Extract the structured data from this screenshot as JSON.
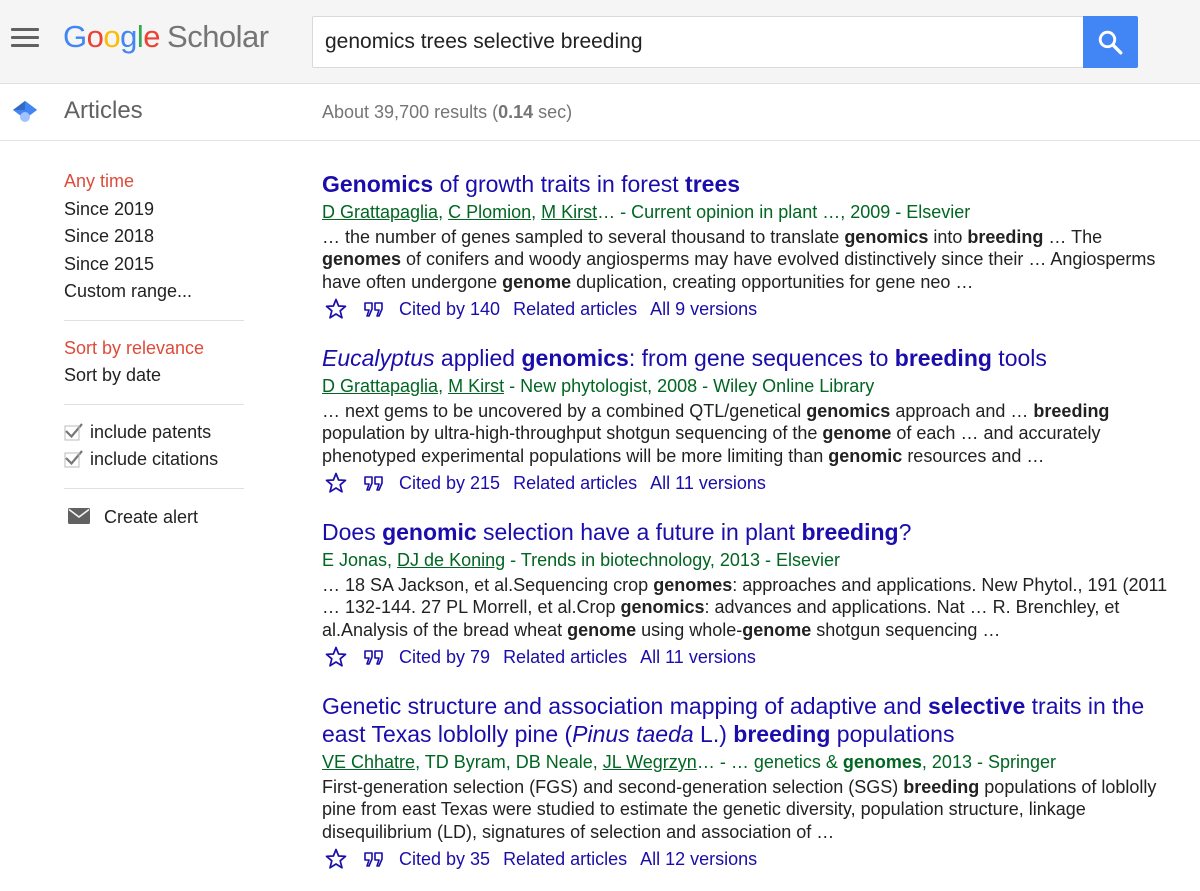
{
  "header": {
    "logo_parts": [
      "G",
      "o",
      "o",
      "g",
      "l",
      "e"
    ],
    "logo_product": "Scholar",
    "search_query": "genomics trees selective breeding",
    "brand_colors": {
      "blue": "#4285f4",
      "red": "#ea4335",
      "yellow": "#fbbc05",
      "green": "#34a853"
    }
  },
  "subheader": {
    "section": "Articles",
    "results_prefix": "About 39,700 results (",
    "results_time": "0.14",
    "results_suffix": " sec)"
  },
  "sidebar": {
    "time_filters": [
      "Any time",
      "Since 2019",
      "Since 2018",
      "Since 2015",
      "Custom range..."
    ],
    "sort_options": [
      "Sort by relevance",
      "Sort by date"
    ],
    "checkboxes": [
      "include patents",
      "include citations"
    ],
    "create_alert": "Create alert",
    "active_color": "#dd4b39"
  },
  "results": [
    {
      "title": [
        {
          "t": "Genomics",
          "b": true
        },
        {
          "t": " of growth traits in forest "
        },
        {
          "t": "trees",
          "b": true
        }
      ],
      "meta": [
        {
          "t": "D Grattapaglia",
          "u": true
        },
        {
          "t": ", "
        },
        {
          "t": "C Plomion",
          "u": true
        },
        {
          "t": ", "
        },
        {
          "t": "M Kirst",
          "u": true
        },
        {
          "t": "… - Current opinion in plant …, 2009 - Elsevier"
        }
      ],
      "snippet": [
        {
          "t": "… the number of genes sampled to several thousand to translate "
        },
        {
          "t": "genomics",
          "b": true
        },
        {
          "t": " into "
        },
        {
          "t": "breeding",
          "b": true
        },
        {
          "t": " … The "
        },
        {
          "t": "genomes",
          "b": true
        },
        {
          "t": " of conifers and woody angiosperms may have evolved distinctively since their … Angiosperms have often undergone "
        },
        {
          "t": "genome",
          "b": true
        },
        {
          "t": " duplication, creating opportunities for gene neo …"
        }
      ],
      "cited": "Cited by 140",
      "related": "Related articles",
      "versions": "All 9 versions"
    },
    {
      "title": [
        {
          "t": "Eucalyptus",
          "i": true
        },
        {
          "t": " applied "
        },
        {
          "t": "genomics",
          "b": true
        },
        {
          "t": ": from gene sequences to "
        },
        {
          "t": "breeding",
          "b": true
        },
        {
          "t": " tools"
        }
      ],
      "meta": [
        {
          "t": "D Grattapaglia",
          "u": true
        },
        {
          "t": ", "
        },
        {
          "t": "M Kirst",
          "u": true
        },
        {
          "t": " - New phytologist, 2008 - Wiley Online Library"
        }
      ],
      "snippet": [
        {
          "t": "… next gems to be uncovered by a combined QTL/genetical "
        },
        {
          "t": "genomics",
          "b": true
        },
        {
          "t": " approach and … "
        },
        {
          "t": "breeding",
          "b": true
        },
        {
          "t": " population by ultra-high-throughput shotgun sequencing of the "
        },
        {
          "t": "genome",
          "b": true
        },
        {
          "t": " of each … and accurately phenotyped experimental populations will be more limiting than "
        },
        {
          "t": "genomic",
          "b": true
        },
        {
          "t": " resources and …"
        }
      ],
      "cited": "Cited by 215",
      "related": "Related articles",
      "versions": "All 11 versions"
    },
    {
      "title": [
        {
          "t": "Does "
        },
        {
          "t": "genomic",
          "b": true
        },
        {
          "t": " selection have a future in plant "
        },
        {
          "t": "breeding",
          "b": true
        },
        {
          "t": "?"
        }
      ],
      "meta": [
        {
          "t": "E Jonas, "
        },
        {
          "t": "DJ de Koning",
          "u": true
        },
        {
          "t": " - Trends in biotechnology, 2013 - Elsevier"
        }
      ],
      "snippet": [
        {
          "t": "… 18 SA Jackson, et al.Sequencing crop "
        },
        {
          "t": "genomes",
          "b": true
        },
        {
          "t": ": approaches and applications. New Phytol., 191 (2011 … 132-144. 27 PL Morrell, et al.Crop "
        },
        {
          "t": "genomics",
          "b": true
        },
        {
          "t": ": advances and applications. Nat … R. Brenchley, et al.Analysis of the bread wheat "
        },
        {
          "t": "genome",
          "b": true
        },
        {
          "t": " using whole-"
        },
        {
          "t": "genome",
          "b": true
        },
        {
          "t": " shotgun sequencing …"
        }
      ],
      "cited": "Cited by 79",
      "related": "Related articles",
      "versions": "All 11 versions"
    },
    {
      "title": [
        {
          "t": "Genetic structure and association mapping of adaptive and "
        },
        {
          "t": "selective",
          "b": true
        },
        {
          "t": " traits in the east Texas loblolly pine ("
        },
        {
          "t": "Pinus taeda",
          "i": true
        },
        {
          "t": " L.) "
        },
        {
          "t": "breeding",
          "b": true
        },
        {
          "t": " populations"
        }
      ],
      "meta": [
        {
          "t": "VE Chhatre",
          "u": true
        },
        {
          "t": ", TD Byram, DB Neale, "
        },
        {
          "t": "JL Wegrzyn",
          "u": true
        },
        {
          "t": "… - … genetics & "
        },
        {
          "t": "genomes",
          "b": true
        },
        {
          "t": ", 2013 - Springer"
        }
      ],
      "snippet": [
        {
          "t": "First-generation selection (FGS) and second-generation selection (SGS) "
        },
        {
          "t": "breeding",
          "b": true
        },
        {
          "t": " populations of loblolly pine from east Texas were studied to estimate the genetic diversity, population structure, linkage disequilibrium (LD), signatures of selection and association of …"
        }
      ],
      "cited": "Cited by 35",
      "related": "Related articles",
      "versions": "All 12 versions"
    }
  ]
}
